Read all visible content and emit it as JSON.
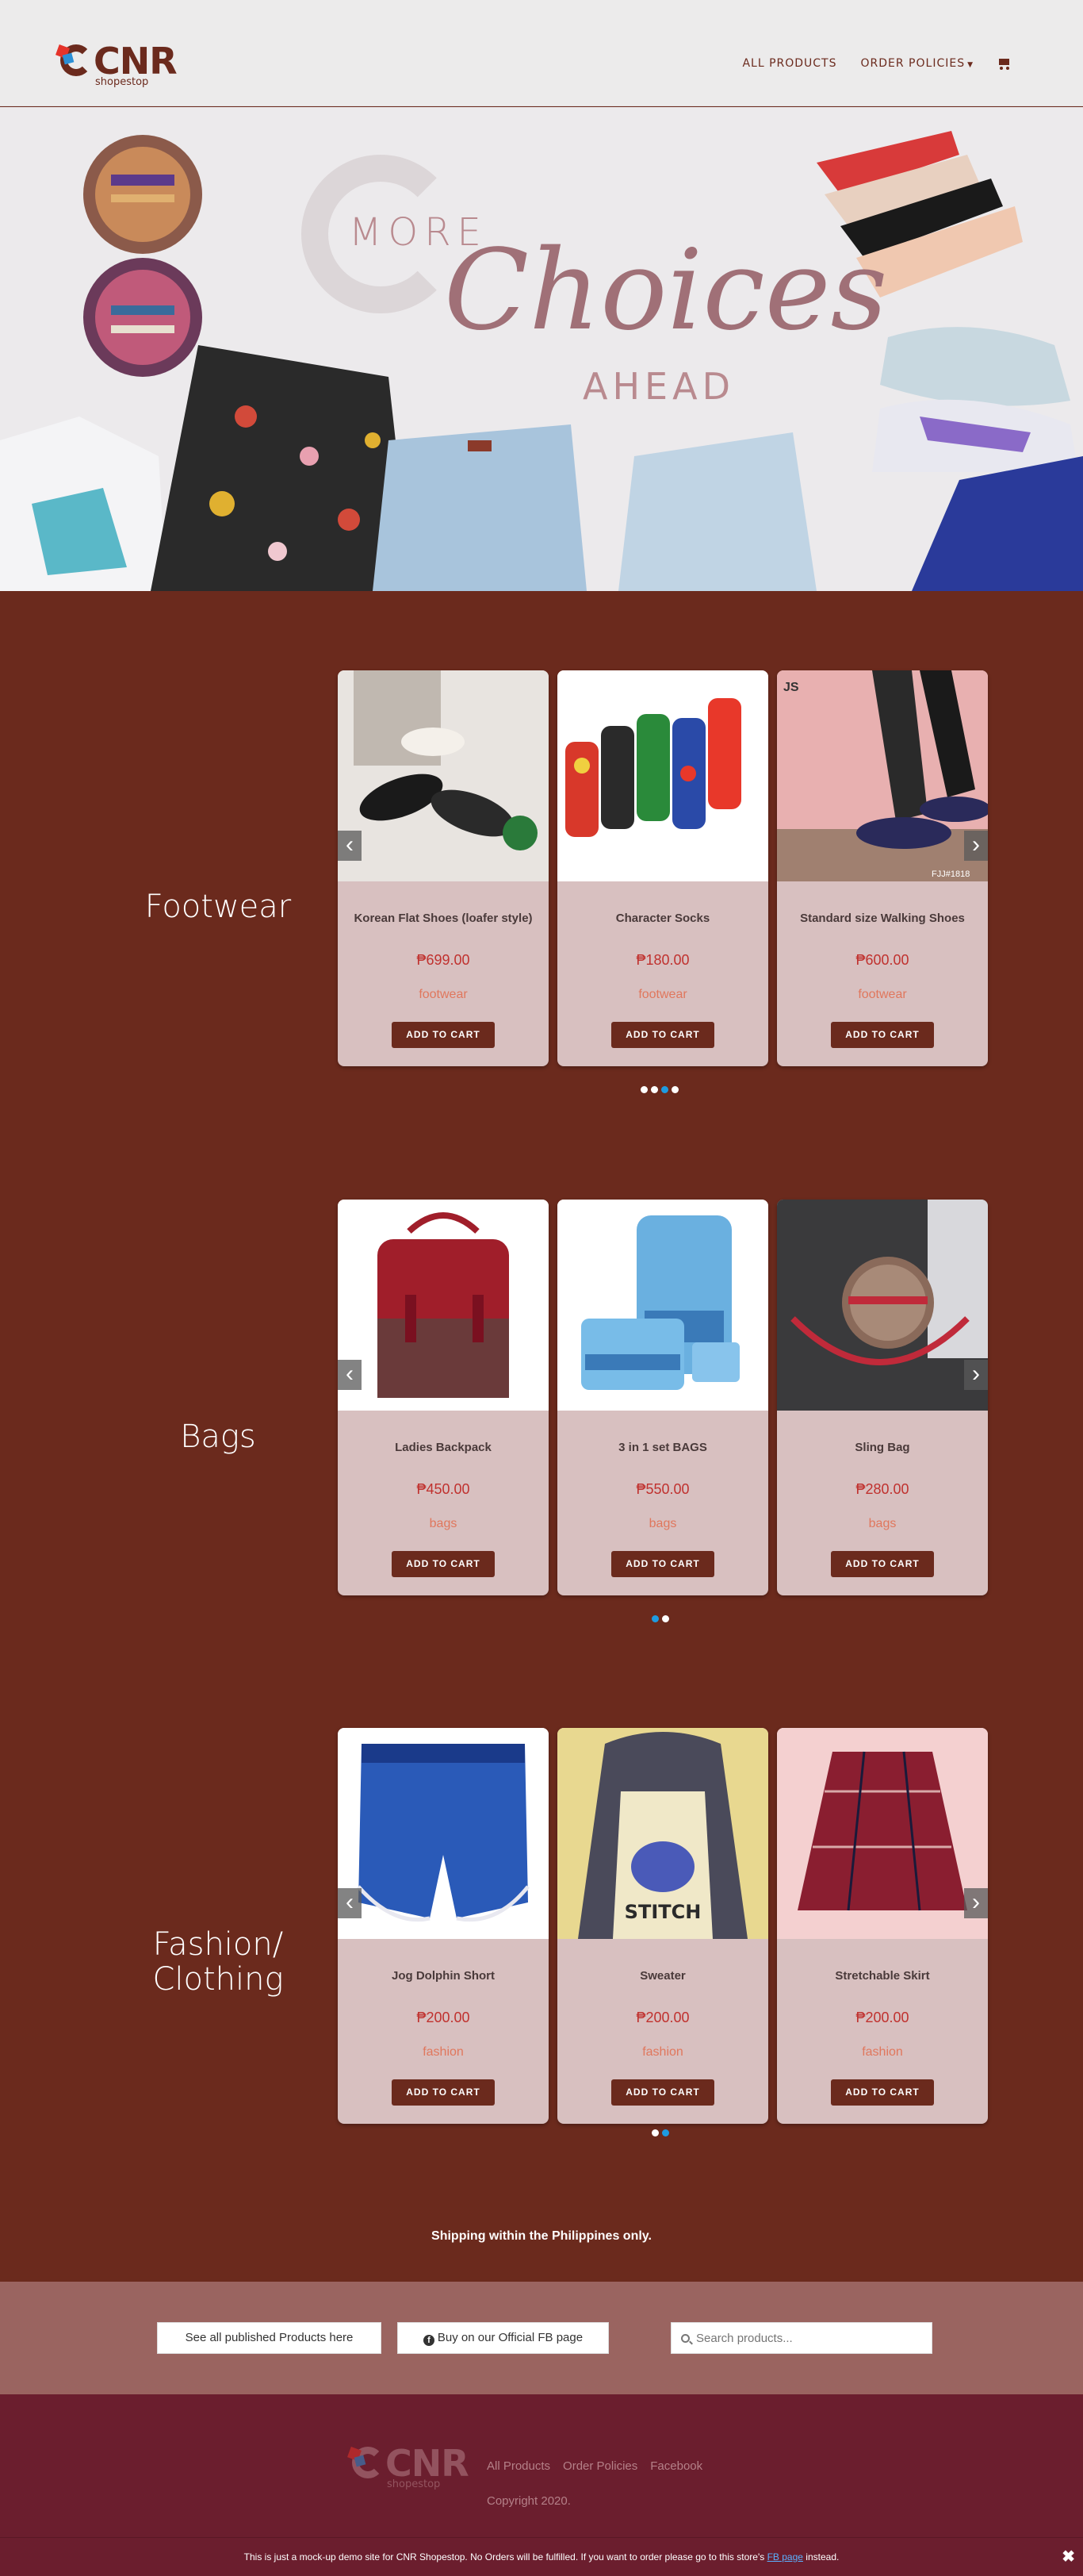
{
  "header": {
    "logo_text": "CNR",
    "logo_sub": "shopestop",
    "nav": [
      "ALL PRODUCTS",
      "ORDER POLICIES"
    ],
    "cart_icon": "cart-icon"
  },
  "hero": {
    "line1": "MORE",
    "line2": "Choices",
    "line3": "AHEAD"
  },
  "categories": [
    {
      "title": "Footwear",
      "products": [
        {
          "name": "Korean Flat Shoes (loafer style)",
          "price": "₱699.00",
          "category": "footwear",
          "button": "ADD TO CART"
        },
        {
          "name": "Character Socks",
          "price": "₱180.00",
          "category": "footwear",
          "button": "ADD TO CART"
        },
        {
          "name": "Standard size Walking Shoes",
          "price": "₱600.00",
          "category": "footwear",
          "button": "ADD TO CART"
        }
      ],
      "dots": 4,
      "active_dot": 2
    },
    {
      "title": "Bags",
      "products": [
        {
          "name": "Ladies Backpack",
          "price": "₱450.00",
          "category": "bags",
          "button": "ADD TO CART"
        },
        {
          "name": "3 in 1 set BAGS",
          "price": "₱550.00",
          "category": "bags",
          "button": "ADD TO CART"
        },
        {
          "name": "Sling Bag",
          "price": "₱280.00",
          "category": "bags",
          "button": "ADD TO CART"
        }
      ],
      "dots": 2,
      "active_dot": 0
    },
    {
      "title": "Fashion/ Clothing",
      "products": [
        {
          "name": "Jog Dolphin Short",
          "price": "₱200.00",
          "category": "fashion",
          "button": "ADD TO CART"
        },
        {
          "name": "Sweater",
          "price": "₱200.00",
          "category": "fashion",
          "button": "ADD TO CART"
        },
        {
          "name": "Stretchable Skirt",
          "price": "₱200.00",
          "category": "fashion",
          "button": "ADD TO CART"
        }
      ],
      "dots": 2,
      "active_dot": 1
    }
  ],
  "product_image_texts": {
    "walking_shoes_brand": "JS",
    "walking_shoes_code": "FJJ#1818",
    "sweater_print": "STITCH"
  },
  "shipping_note": "Shipping within the Philippines only.",
  "actions": {
    "all_products": "See all published Products here",
    "fb_button": "Buy on our Official FB page",
    "search_placeholder": "Search products..."
  },
  "footer": {
    "links": [
      "All Products",
      "Order Policies",
      "Facebook"
    ],
    "copyright": "Copyright 2020."
  },
  "notice": {
    "text": "This is just a mock-up demo site for CNR Shopestop. No Orders will be fulfilled. If you want to order please go to this store's",
    "link": "FB page",
    "suffix": "instead.",
    "close": "✖"
  },
  "colors": {
    "brand": "#6b2a1d",
    "card_bg": "#d8c0c0",
    "price": "#c0312e",
    "category": "#e0775d",
    "band": "#9a6460",
    "footer": "#6b1e2e",
    "dot_active": "#1e9be0"
  }
}
